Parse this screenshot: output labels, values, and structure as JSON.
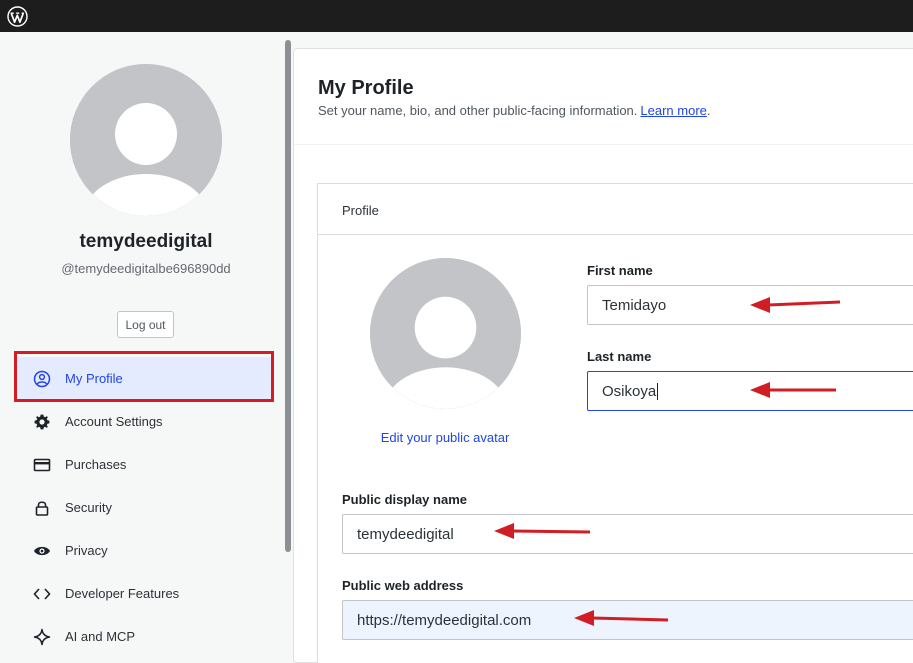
{
  "topbar": {
    "logo_icon": "wordpress-logo-icon"
  },
  "user": {
    "display_name": "temydeedigital",
    "handle": "@temydeedigitalbe696890dd",
    "logout_label": "Log out"
  },
  "nav": {
    "items": [
      {
        "label": "My Profile",
        "icon": "user-circle-icon",
        "active": true
      },
      {
        "label": "Account Settings",
        "icon": "gear-icon",
        "active": false
      },
      {
        "label": "Purchases",
        "icon": "credit-card-icon",
        "active": false
      },
      {
        "label": "Security",
        "icon": "lock-icon",
        "active": false
      },
      {
        "label": "Privacy",
        "icon": "eye-icon",
        "active": false
      },
      {
        "label": "Developer Features",
        "icon": "code-icon",
        "active": false
      },
      {
        "label": "AI and MCP",
        "icon": "sparkle-icon",
        "active": false
      }
    ]
  },
  "page": {
    "title": "My Profile",
    "subtitle": "Set your name, bio, and other public-facing information.",
    "learn_more": "Learn more",
    "subtitle_end": "."
  },
  "profile_card": {
    "header": "Profile",
    "edit_avatar": "Edit your public avatar",
    "first_name": {
      "label": "First name",
      "value": "Temidayo"
    },
    "last_name": {
      "label": "Last name",
      "value": "Osikoya"
    },
    "display_name": {
      "label": "Public display name",
      "value": "temydeedigital"
    },
    "web_address": {
      "label": "Public web address",
      "value": "https://temydeedigital.com"
    }
  },
  "colors": {
    "accent": "#2145e6",
    "annotation_red": "#d11e24",
    "avatar_gray": "#c3c4c7"
  }
}
